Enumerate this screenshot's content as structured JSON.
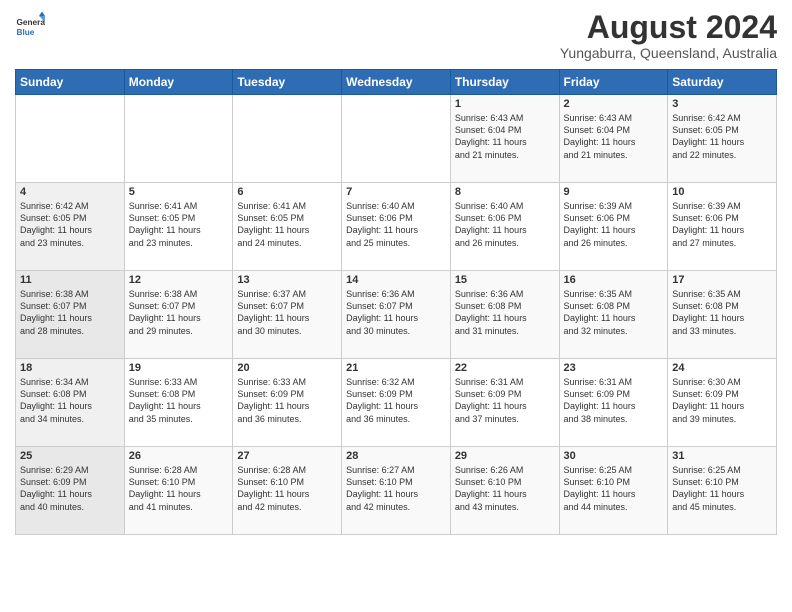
{
  "header": {
    "logo": {
      "general": "General",
      "blue": "Blue"
    },
    "title": "August 2024",
    "subtitle": "Yungaburra, Queensland, Australia"
  },
  "weekdays": [
    "Sunday",
    "Monday",
    "Tuesday",
    "Wednesday",
    "Thursday",
    "Friday",
    "Saturday"
  ],
  "weeks": [
    [
      {
        "day": "",
        "info": ""
      },
      {
        "day": "",
        "info": ""
      },
      {
        "day": "",
        "info": ""
      },
      {
        "day": "",
        "info": ""
      },
      {
        "day": "1",
        "info": "Sunrise: 6:43 AM\nSunset: 6:04 PM\nDaylight: 11 hours\nand 21 minutes."
      },
      {
        "day": "2",
        "info": "Sunrise: 6:43 AM\nSunset: 6:04 PM\nDaylight: 11 hours\nand 21 minutes."
      },
      {
        "day": "3",
        "info": "Sunrise: 6:42 AM\nSunset: 6:05 PM\nDaylight: 11 hours\nand 22 minutes."
      }
    ],
    [
      {
        "day": "4",
        "info": "Sunrise: 6:42 AM\nSunset: 6:05 PM\nDaylight: 11 hours\nand 23 minutes."
      },
      {
        "day": "5",
        "info": "Sunrise: 6:41 AM\nSunset: 6:05 PM\nDaylight: 11 hours\nand 23 minutes."
      },
      {
        "day": "6",
        "info": "Sunrise: 6:41 AM\nSunset: 6:05 PM\nDaylight: 11 hours\nand 24 minutes."
      },
      {
        "day": "7",
        "info": "Sunrise: 6:40 AM\nSunset: 6:06 PM\nDaylight: 11 hours\nand 25 minutes."
      },
      {
        "day": "8",
        "info": "Sunrise: 6:40 AM\nSunset: 6:06 PM\nDaylight: 11 hours\nand 26 minutes."
      },
      {
        "day": "9",
        "info": "Sunrise: 6:39 AM\nSunset: 6:06 PM\nDaylight: 11 hours\nand 26 minutes."
      },
      {
        "day": "10",
        "info": "Sunrise: 6:39 AM\nSunset: 6:06 PM\nDaylight: 11 hours\nand 27 minutes."
      }
    ],
    [
      {
        "day": "11",
        "info": "Sunrise: 6:38 AM\nSunset: 6:07 PM\nDaylight: 11 hours\nand 28 minutes."
      },
      {
        "day": "12",
        "info": "Sunrise: 6:38 AM\nSunset: 6:07 PM\nDaylight: 11 hours\nand 29 minutes."
      },
      {
        "day": "13",
        "info": "Sunrise: 6:37 AM\nSunset: 6:07 PM\nDaylight: 11 hours\nand 30 minutes."
      },
      {
        "day": "14",
        "info": "Sunrise: 6:36 AM\nSunset: 6:07 PM\nDaylight: 11 hours\nand 30 minutes."
      },
      {
        "day": "15",
        "info": "Sunrise: 6:36 AM\nSunset: 6:08 PM\nDaylight: 11 hours\nand 31 minutes."
      },
      {
        "day": "16",
        "info": "Sunrise: 6:35 AM\nSunset: 6:08 PM\nDaylight: 11 hours\nand 32 minutes."
      },
      {
        "day": "17",
        "info": "Sunrise: 6:35 AM\nSunset: 6:08 PM\nDaylight: 11 hours\nand 33 minutes."
      }
    ],
    [
      {
        "day": "18",
        "info": "Sunrise: 6:34 AM\nSunset: 6:08 PM\nDaylight: 11 hours\nand 34 minutes."
      },
      {
        "day": "19",
        "info": "Sunrise: 6:33 AM\nSunset: 6:08 PM\nDaylight: 11 hours\nand 35 minutes."
      },
      {
        "day": "20",
        "info": "Sunrise: 6:33 AM\nSunset: 6:09 PM\nDaylight: 11 hours\nand 36 minutes."
      },
      {
        "day": "21",
        "info": "Sunrise: 6:32 AM\nSunset: 6:09 PM\nDaylight: 11 hours\nand 36 minutes."
      },
      {
        "day": "22",
        "info": "Sunrise: 6:31 AM\nSunset: 6:09 PM\nDaylight: 11 hours\nand 37 minutes."
      },
      {
        "day": "23",
        "info": "Sunrise: 6:31 AM\nSunset: 6:09 PM\nDaylight: 11 hours\nand 38 minutes."
      },
      {
        "day": "24",
        "info": "Sunrise: 6:30 AM\nSunset: 6:09 PM\nDaylight: 11 hours\nand 39 minutes."
      }
    ],
    [
      {
        "day": "25",
        "info": "Sunrise: 6:29 AM\nSunset: 6:09 PM\nDaylight: 11 hours\nand 40 minutes."
      },
      {
        "day": "26",
        "info": "Sunrise: 6:28 AM\nSunset: 6:10 PM\nDaylight: 11 hours\nand 41 minutes."
      },
      {
        "day": "27",
        "info": "Sunrise: 6:28 AM\nSunset: 6:10 PM\nDaylight: 11 hours\nand 42 minutes."
      },
      {
        "day": "28",
        "info": "Sunrise: 6:27 AM\nSunset: 6:10 PM\nDaylight: 11 hours\nand 42 minutes."
      },
      {
        "day": "29",
        "info": "Sunrise: 6:26 AM\nSunset: 6:10 PM\nDaylight: 11 hours\nand 43 minutes."
      },
      {
        "day": "30",
        "info": "Sunrise: 6:25 AM\nSunset: 6:10 PM\nDaylight: 11 hours\nand 44 minutes."
      },
      {
        "day": "31",
        "info": "Sunrise: 6:25 AM\nSunset: 6:10 PM\nDaylight: 11 hours\nand 45 minutes."
      }
    ]
  ]
}
